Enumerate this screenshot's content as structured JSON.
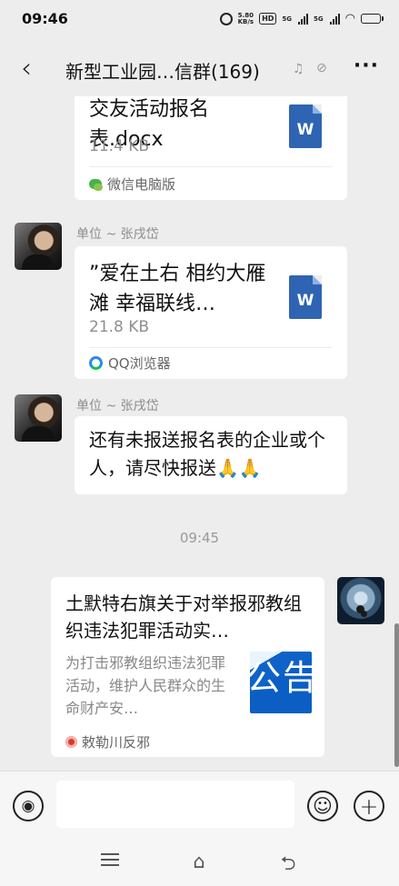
{
  "status_bar": {
    "time": "09:46",
    "net_speed": "5.80",
    "net_unit": "KB/s",
    "hd_label": "HD",
    "network_1": "5G",
    "network_2": "5G",
    "battery_level": 0.9
  },
  "header": {
    "title": "新型工业园…信群(169)",
    "more_label": "···",
    "back_icon": "chevron-left-icon",
    "mute_icon": "bell-off-icon",
    "lock_icon": "lock-icon"
  },
  "messages": [
    {
      "type": "file",
      "name": "交友活动报名表.docx",
      "size": "11.4 KB",
      "file_badge": "W",
      "source": "微信电脑版"
    },
    {
      "type": "file",
      "sender": "单位 ~ 张戌岱",
      "name": "”爱在土右 相约大雁滩 幸福联线…",
      "size": "21.8 KB",
      "file_badge": "W",
      "source": "QQ浏览器"
    },
    {
      "type": "text",
      "sender": "单位 ~ 张戌岱",
      "text": "还有未报送报名表的企业或个人，请尽快报送🙏🙏"
    },
    {
      "type": "time",
      "time": "09:45"
    },
    {
      "type": "article",
      "title": "土默特右旗关于对举报邪教组织违法犯罪活动实…",
      "description": "为打击邪教组织违法犯罪活动，维护人民群众的生命财产安…",
      "thumbnail_text": "公告",
      "source": "敕勒川反邪"
    }
  ],
  "input_bar": {
    "placeholder": "",
    "voice_icon": "voice-icon",
    "emoji_icon": "emoji-icon",
    "plus_icon": "plus-icon",
    "emoji_glyph": "☺",
    "plus_glyph": "+",
    "voice_glyph": "◉"
  },
  "system_nav": {
    "home_glyph": "⌂",
    "back_glyph": "⮌"
  },
  "colors": {
    "background": "#ededed",
    "bubble": "#ffffff",
    "doc_blue": "#2f64b2",
    "secondary_text": "#8d8d8d"
  }
}
